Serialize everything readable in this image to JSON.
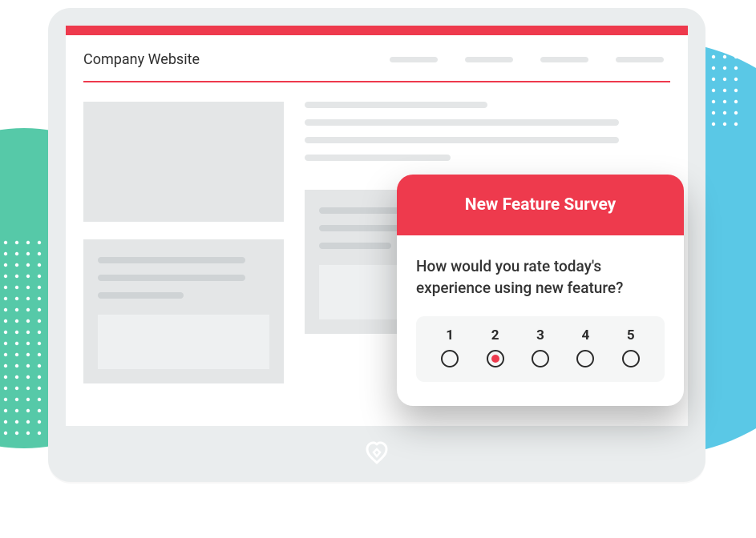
{
  "site": {
    "title": "Company Website"
  },
  "survey": {
    "title": "New Feature Survey",
    "question": "How would you rate today's experience using new feature?",
    "options": [
      "1",
      "2",
      "3",
      "4",
      "5"
    ],
    "selected_index": 1
  },
  "colors": {
    "accent": "#ee3a4d",
    "teal": "#56c9a8",
    "blue": "#5ac8e6"
  }
}
